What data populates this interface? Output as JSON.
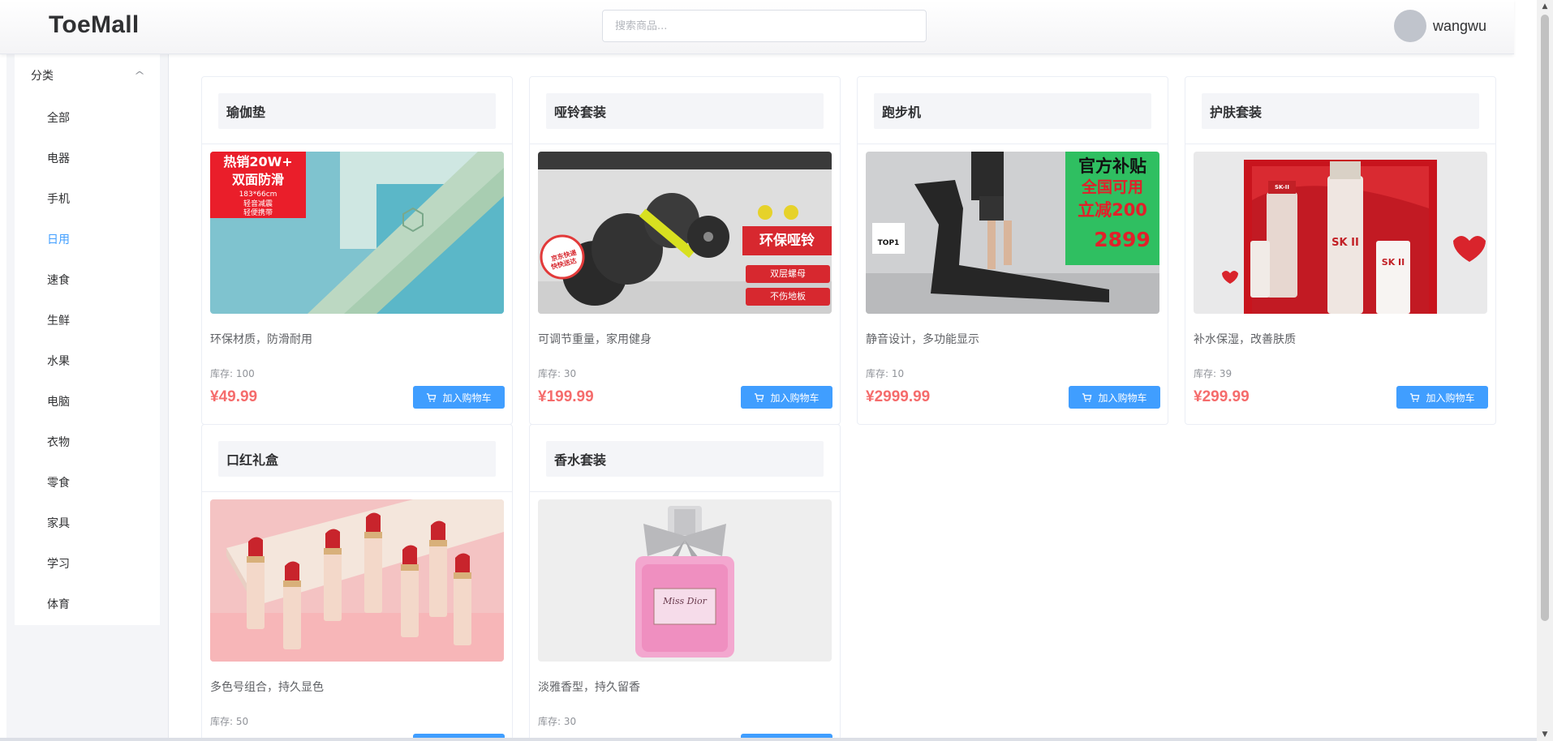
{
  "header": {
    "logo": "ToeMall",
    "search_placeholder": "搜索商品...",
    "username": "wangwu"
  },
  "sidebar": {
    "section_title": "分类",
    "items": [
      "全部",
      "电器",
      "手机",
      "日用",
      "速食",
      "生鲜",
      "水果",
      "电脑",
      "衣物",
      "零食",
      "家具",
      "学习",
      "体育"
    ],
    "active_item": "日用"
  },
  "products": [
    {
      "title": "瑜伽垫",
      "desc": "环保材质，防滑耐用",
      "stock": "库存: 100",
      "price": "¥49.99",
      "button": "加入购物车",
      "image_text": [
        "热销20W+",
        "双面防滑",
        "183*66cm",
        "轻音减震",
        "轻便携带"
      ]
    },
    {
      "title": "哑铃套装",
      "desc": "可调节重量，家用健身",
      "stock": "库存: 30",
      "price": "¥199.99",
      "button": "加入购物车",
      "image_text": [
        "京东快递",
        "快快送达",
        "环保哑铃",
        "双层螺母",
        "不伤地板"
      ]
    },
    {
      "title": "跑步机",
      "desc": "静音设计，多功能显示",
      "stock": "库存: 10",
      "price": "¥2999.99",
      "button": "加入购物车",
      "image_text": [
        "官方补贴",
        "全国可用",
        "立减200",
        "2899",
        "TOP1"
      ]
    },
    {
      "title": "护肤套装",
      "desc": "补水保湿，改善肤质",
      "stock": "库存: 39",
      "price": "¥299.99",
      "button": "加入购物车",
      "image_text": [
        "SK-II",
        "SK II",
        "SK II"
      ]
    },
    {
      "title": "口红礼盒",
      "desc": "多色号组合，持久显色",
      "stock": "库存: 50",
      "price": "",
      "button": "",
      "image_text": []
    },
    {
      "title": "香水套装",
      "desc": "淡雅香型，持久留香",
      "stock": "库存: 30",
      "price": "",
      "button": "",
      "image_text": [
        "Miss Dior"
      ]
    }
  ],
  "colors": {
    "accent": "#409eff",
    "price": "#f56c6c",
    "sidebar_bg": "#f4f5f8"
  }
}
